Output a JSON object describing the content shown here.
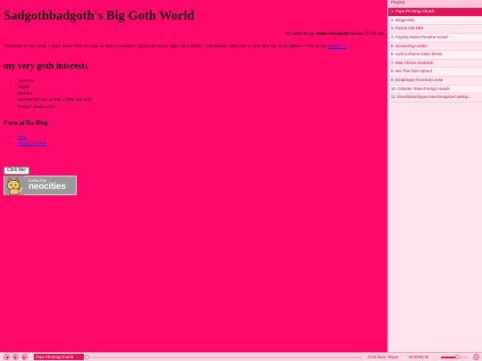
{
  "site": {
    "title": "Sadgothbadgoth's Big Goth World",
    "marquee": "!!! what is up sadgothbadgoth nation !!! !!! wa",
    "welcome_text": "Welcome to my blog! I don't know how to code so this is probably gonna be really ugly for a while. I am mostly here just to yell into the void. Here's a link to my",
    "welcome_link": "tumblr :)",
    "interests_heading": "my very goth interests",
    "interests": [
      "concerts",
      "music",
      "fashion",
      "movies but not in like a film bro way",
      "books? kinda sorta"
    ],
    "parts_heading": "Parts of Da Blog",
    "parts": [
      "blog",
      "music reviews"
    ],
    "click_button": "Click Me!",
    "badge": {
      "small": "hosted by",
      "big": "neocities"
    }
  },
  "playlist": {
    "header": "Playlist",
    "items": [
      "1. Pope PR-Drug Church",
      "2. Minge-GEL",
      "3. Poison Girl-HIM",
      "4. Psychic Dance Routine-Scowl",
      "5. Screaming-Loathe",
      "6. such.a.shame-Static Dress",
      "7. Was Choice-Xvolomb",
      "8. Not That Nice-Speed",
      "9. Deadringer-Knocked Loose",
      "10. Chlorine Tears-Foreign Hands",
      "11. bloodstainedeyes-SeeYouSpaceCowboy..."
    ],
    "active_index": 0
  },
  "player": {
    "now_playing": "Pope PR-Drug Church",
    "playlist_label": "SCM Music Player",
    "time": "00:00/02:32",
    "volume_fraction": 0.6,
    "progress_fraction": 0.0
  },
  "colors": {
    "page_bg": "#ff0a6c",
    "accent": "#e8145a",
    "playlist_bg": "#ffe4ee"
  }
}
